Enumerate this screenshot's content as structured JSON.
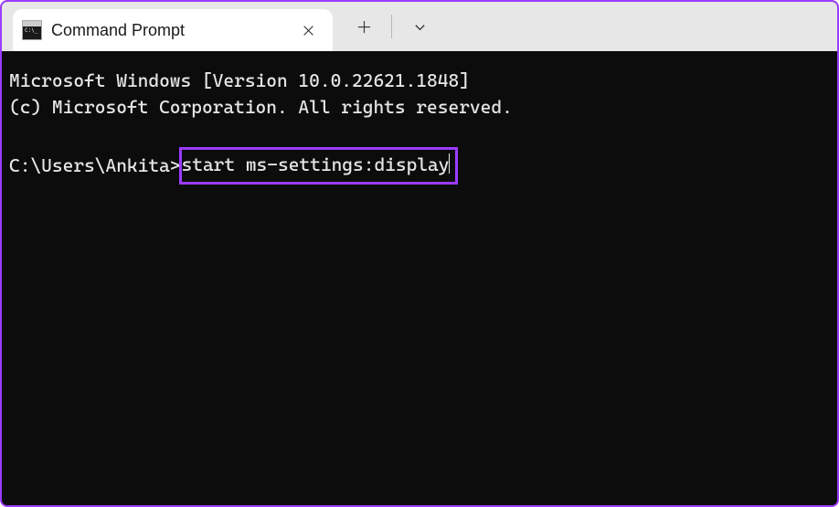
{
  "window": {
    "tab_title": "Command Prompt",
    "tab_icon_text": "C:\\_"
  },
  "terminal": {
    "line1": "Microsoft Windows [Version 10.0.22621.1848]",
    "line2": "(c) Microsoft Corporation. All rights reserved.",
    "prompt": "C:\\Users\\Ankita>",
    "command": "start ms-settings:display"
  },
  "colors": {
    "accent": "#9b3bff",
    "terminal_bg": "#0c0c0c",
    "terminal_fg": "#e6e6e6",
    "titlebar_bg": "#e7e7e7"
  }
}
